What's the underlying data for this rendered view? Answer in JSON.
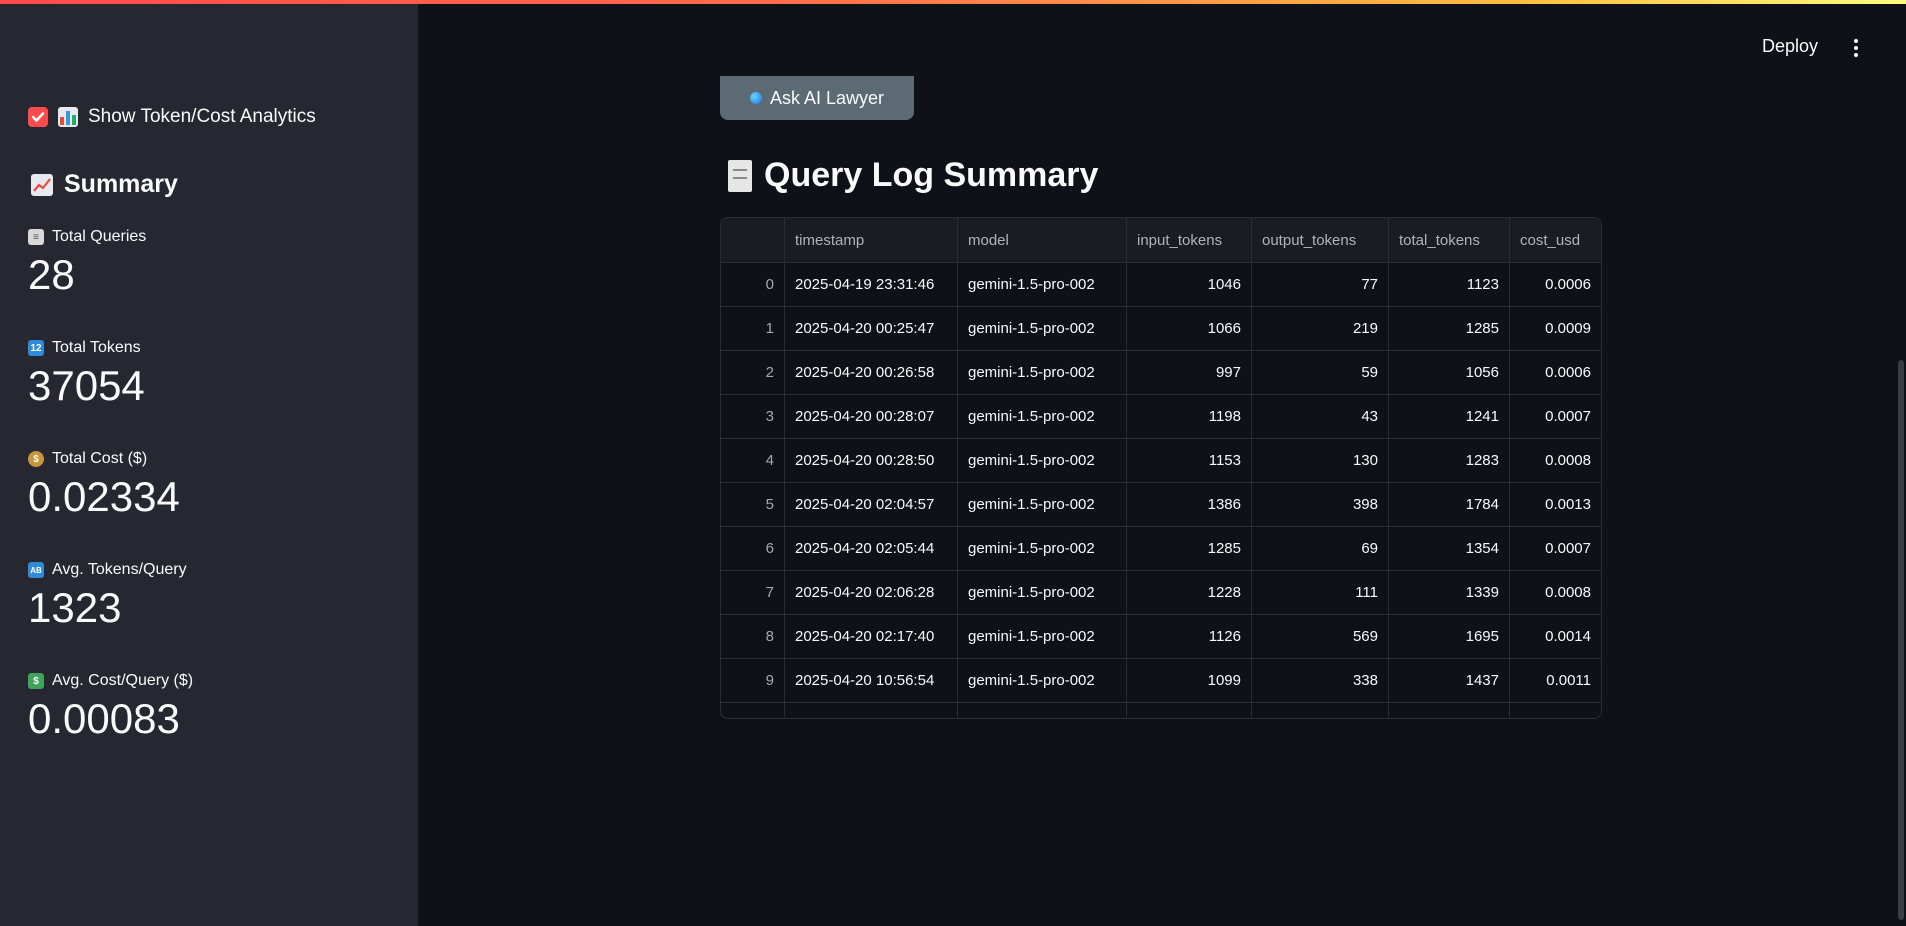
{
  "header": {
    "deploy_label": "Deploy"
  },
  "sidebar": {
    "checkbox_label": "Show Token/Cost Analytics",
    "checkbox_checked": true,
    "summary_title": "Summary",
    "metrics": [
      {
        "label": "Total Queries",
        "value": "28",
        "icon": "receipt-icon"
      },
      {
        "label": "Total Tokens",
        "value": "37054",
        "icon": "numbers-icon"
      },
      {
        "label": "Total Cost ($)",
        "value": "0.02334",
        "icon": "money-bag-icon"
      },
      {
        "label": "Avg. Tokens/Query",
        "value": "1323",
        "icon": "abcd-icon"
      },
      {
        "label": "Avg. Cost/Query ($)",
        "value": "0.00083",
        "icon": "flying-money-icon"
      }
    ]
  },
  "main": {
    "ask_button_label": "Ask AI Lawyer",
    "section_title": "Query Log Summary",
    "table": {
      "columns": [
        "",
        "timestamp",
        "model",
        "input_tokens",
        "output_tokens",
        "total_tokens",
        "cost_usd"
      ],
      "rows": [
        [
          "0",
          "2025-04-19 23:31:46",
          "gemini-1.5-pro-002",
          "1046",
          "77",
          "1123",
          "0.0006"
        ],
        [
          "1",
          "2025-04-20 00:25:47",
          "gemini-1.5-pro-002",
          "1066",
          "219",
          "1285",
          "0.0009"
        ],
        [
          "2",
          "2025-04-20 00:26:58",
          "gemini-1.5-pro-002",
          "997",
          "59",
          "1056",
          "0.0006"
        ],
        [
          "3",
          "2025-04-20 00:28:07",
          "gemini-1.5-pro-002",
          "1198",
          "43",
          "1241",
          "0.0007"
        ],
        [
          "4",
          "2025-04-20 00:28:50",
          "gemini-1.5-pro-002",
          "1153",
          "130",
          "1283",
          "0.0008"
        ],
        [
          "5",
          "2025-04-20 02:04:57",
          "gemini-1.5-pro-002",
          "1386",
          "398",
          "1784",
          "0.0013"
        ],
        [
          "6",
          "2025-04-20 02:05:44",
          "gemini-1.5-pro-002",
          "1285",
          "69",
          "1354",
          "0.0007"
        ],
        [
          "7",
          "2025-04-20 02:06:28",
          "gemini-1.5-pro-002",
          "1228",
          "111",
          "1339",
          "0.0008"
        ],
        [
          "8",
          "2025-04-20 02:17:40",
          "gemini-1.5-pro-002",
          "1126",
          "569",
          "1695",
          "0.0014"
        ],
        [
          "9",
          "2025-04-20 10:56:54",
          "gemini-1.5-pro-002",
          "1099",
          "338",
          "1437",
          "0.0011"
        ]
      ]
    }
  },
  "colors": {
    "accent": "#ff4b4b",
    "sidebar_bg": "#262730",
    "main_bg": "#0e1117",
    "button_bg": "#5c6b73"
  }
}
